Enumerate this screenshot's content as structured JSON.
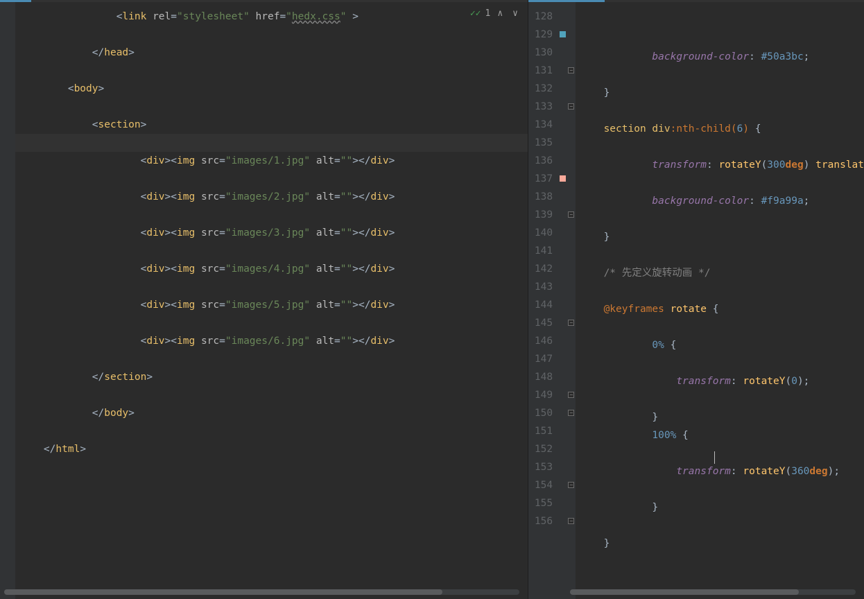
{
  "find": {
    "count": "1"
  },
  "left": {
    "startLine": 4,
    "highlightRow": 8,
    "lines": [
      {
        "indent": 4,
        "tokens": [
          [
            "punct",
            "<"
          ],
          [
            "tag",
            "link"
          ],
          [
            "punct",
            " "
          ],
          [
            "attr",
            "rel"
          ],
          [
            "punct",
            "="
          ],
          [
            "str",
            "\"stylesheet\""
          ],
          [
            "punct",
            " "
          ],
          [
            "attr",
            "href"
          ],
          [
            "punct",
            "="
          ],
          [
            "str",
            "\""
          ],
          [
            "href",
            "hedx.css"
          ],
          [
            "str",
            "\""
          ],
          [
            "punct",
            " >"
          ]
        ]
      },
      {
        "indent": 0,
        "tokens": []
      },
      {
        "indent": 3,
        "tokens": [
          [
            "punct",
            "</"
          ],
          [
            "tag",
            "head"
          ],
          [
            "punct",
            ">"
          ]
        ]
      },
      {
        "indent": 0,
        "tokens": []
      },
      {
        "indent": 2,
        "tokens": [
          [
            "punct",
            "<"
          ],
          [
            "tag",
            "body"
          ],
          [
            "punct",
            ">"
          ]
        ]
      },
      {
        "indent": 0,
        "tokens": []
      },
      {
        "indent": 3,
        "tokens": [
          [
            "punct",
            "<"
          ],
          [
            "tag",
            "section"
          ],
          [
            "punct",
            ">"
          ]
        ]
      },
      {
        "indent": 0,
        "tokens": []
      },
      {
        "indent": 5,
        "tokens": [
          [
            "punct",
            "<"
          ],
          [
            "tag",
            "div"
          ],
          [
            "punct",
            "><"
          ],
          [
            "tag",
            "img"
          ],
          [
            "punct",
            " "
          ],
          [
            "attr",
            "src"
          ],
          [
            "punct",
            "="
          ],
          [
            "str",
            "\"images/1.jpg\""
          ],
          [
            "punct",
            " "
          ],
          [
            "attr",
            "alt"
          ],
          [
            "punct",
            "="
          ],
          [
            "str",
            "\"\""
          ],
          [
            "punct",
            "></"
          ],
          [
            "tag",
            "div"
          ],
          [
            "punct",
            ">"
          ]
        ]
      },
      {
        "indent": 0,
        "tokens": []
      },
      {
        "indent": 5,
        "tokens": [
          [
            "punct",
            "<"
          ],
          [
            "tag",
            "div"
          ],
          [
            "punct",
            "><"
          ],
          [
            "tag",
            "img"
          ],
          [
            "punct",
            " "
          ],
          [
            "attr",
            "src"
          ],
          [
            "punct",
            "="
          ],
          [
            "str",
            "\"images/2.jpg\""
          ],
          [
            "punct",
            " "
          ],
          [
            "attr",
            "alt"
          ],
          [
            "punct",
            "="
          ],
          [
            "str",
            "\"\""
          ],
          [
            "punct",
            "></"
          ],
          [
            "tag",
            "div"
          ],
          [
            "punct",
            ">"
          ]
        ]
      },
      {
        "indent": 0,
        "tokens": []
      },
      {
        "indent": 5,
        "tokens": [
          [
            "punct",
            "<"
          ],
          [
            "tag",
            "div"
          ],
          [
            "punct",
            "><"
          ],
          [
            "tag",
            "img"
          ],
          [
            "punct",
            " "
          ],
          [
            "attr",
            "src"
          ],
          [
            "punct",
            "="
          ],
          [
            "str",
            "\"images/3.jpg\""
          ],
          [
            "punct",
            " "
          ],
          [
            "attr",
            "alt"
          ],
          [
            "punct",
            "="
          ],
          [
            "str",
            "\"\""
          ],
          [
            "punct",
            "></"
          ],
          [
            "tag",
            "div"
          ],
          [
            "punct",
            ">"
          ]
        ]
      },
      {
        "indent": 0,
        "tokens": []
      },
      {
        "indent": 5,
        "tokens": [
          [
            "punct",
            "<"
          ],
          [
            "tag",
            "div"
          ],
          [
            "punct",
            "><"
          ],
          [
            "tag",
            "img"
          ],
          [
            "punct",
            " "
          ],
          [
            "attr",
            "src"
          ],
          [
            "punct",
            "="
          ],
          [
            "str",
            "\"images/4.jpg\""
          ],
          [
            "punct",
            " "
          ],
          [
            "attr",
            "alt"
          ],
          [
            "punct",
            "="
          ],
          [
            "str",
            "\"\""
          ],
          [
            "punct",
            "></"
          ],
          [
            "tag",
            "div"
          ],
          [
            "punct",
            ">"
          ]
        ]
      },
      {
        "indent": 0,
        "tokens": []
      },
      {
        "indent": 5,
        "tokens": [
          [
            "punct",
            "<"
          ],
          [
            "tag",
            "div"
          ],
          [
            "punct",
            "><"
          ],
          [
            "tag",
            "img"
          ],
          [
            "punct",
            " "
          ],
          [
            "attr",
            "src"
          ],
          [
            "punct",
            "="
          ],
          [
            "str",
            "\"images/5.jpg\""
          ],
          [
            "punct",
            " "
          ],
          [
            "attr",
            "alt"
          ],
          [
            "punct",
            "="
          ],
          [
            "str",
            "\"\""
          ],
          [
            "punct",
            "></"
          ],
          [
            "tag",
            "div"
          ],
          [
            "punct",
            ">"
          ]
        ]
      },
      {
        "indent": 0,
        "tokens": []
      },
      {
        "indent": 5,
        "tokens": [
          [
            "punct",
            "<"
          ],
          [
            "tag",
            "div"
          ],
          [
            "punct",
            "><"
          ],
          [
            "tag",
            "img"
          ],
          [
            "punct",
            " "
          ],
          [
            "attr",
            "src"
          ],
          [
            "punct",
            "="
          ],
          [
            "str",
            "\"images/6.jpg\""
          ],
          [
            "punct",
            " "
          ],
          [
            "attr",
            "alt"
          ],
          [
            "punct",
            "="
          ],
          [
            "str",
            "\"\""
          ],
          [
            "punct",
            "></"
          ],
          [
            "tag",
            "div"
          ],
          [
            "punct",
            ">"
          ]
        ]
      },
      {
        "indent": 0,
        "tokens": []
      },
      {
        "indent": 3,
        "tokens": [
          [
            "punct",
            "</"
          ],
          [
            "tag",
            "section"
          ],
          [
            "punct",
            ">"
          ]
        ]
      },
      {
        "indent": 0,
        "tokens": []
      },
      {
        "indent": 3,
        "tokens": [
          [
            "punct",
            "</"
          ],
          [
            "tag",
            "body"
          ],
          [
            "punct",
            ">"
          ]
        ]
      },
      {
        "indent": 0,
        "tokens": []
      },
      {
        "indent": 1,
        "tokens": [
          [
            "punct",
            "</"
          ],
          [
            "tag",
            "html"
          ],
          [
            "punct",
            ">"
          ]
        ]
      }
    ]
  },
  "right": {
    "startLine": 128,
    "swatches": {
      "129": "#50a3bc",
      "137": "#f9a99a"
    },
    "folds": [
      131,
      133,
      139,
      145,
      149,
      150,
      154,
      156
    ],
    "lines": [
      {
        "indent": 0,
        "tokens": []
      },
      {
        "indent": 3,
        "tokens": [
          [
            "prop",
            "background-color"
          ],
          [
            "punct",
            ": "
          ],
          [
            "num",
            "#50a3bc"
          ],
          [
            "punct",
            ";"
          ]
        ]
      },
      {
        "indent": 0,
        "tokens": []
      },
      {
        "indent": 1,
        "tokens": [
          [
            "punct",
            "}"
          ]
        ]
      },
      {
        "indent": 0,
        "tokens": []
      },
      {
        "indent": 1,
        "tokens": [
          [
            "sel",
            "section"
          ],
          [
            "punct",
            " "
          ],
          [
            "sel",
            "div"
          ],
          [
            "pseudo",
            ":nth-child("
          ],
          [
            "num",
            "6"
          ],
          [
            "pseudo",
            ") "
          ],
          [
            "punct",
            "{"
          ]
        ]
      },
      {
        "indent": 0,
        "tokens": []
      },
      {
        "indent": 3,
        "tokens": [
          [
            "prop",
            "transform"
          ],
          [
            "punct",
            ": "
          ],
          [
            "func",
            "rotateY"
          ],
          [
            "punct",
            "("
          ],
          [
            "num",
            "300"
          ],
          [
            "unit",
            "deg"
          ],
          [
            "punct",
            ") "
          ],
          [
            "func",
            "translat"
          ]
        ]
      },
      {
        "indent": 0,
        "tokens": []
      },
      {
        "indent": 3,
        "tokens": [
          [
            "prop",
            "background-color"
          ],
          [
            "punct",
            ": "
          ],
          [
            "num",
            "#f9a99a"
          ],
          [
            "punct",
            ";"
          ]
        ]
      },
      {
        "indent": 0,
        "tokens": []
      },
      {
        "indent": 1,
        "tokens": [
          [
            "punct",
            "}"
          ]
        ]
      },
      {
        "indent": 0,
        "tokens": []
      },
      {
        "indent": 1,
        "tokens": [
          [
            "comment",
            "/* 先定义旋转动画 */"
          ]
        ]
      },
      {
        "indent": 0,
        "tokens": []
      },
      {
        "indent": 1,
        "tokens": [
          [
            "kw",
            "@keyframes"
          ],
          [
            "punct",
            " "
          ],
          [
            "ident",
            "rotate"
          ],
          [
            "punct",
            " {"
          ]
        ]
      },
      {
        "indent": 0,
        "tokens": []
      },
      {
        "indent": 3,
        "tokens": [
          [
            "num",
            "0%"
          ],
          [
            "punct",
            " {"
          ]
        ]
      },
      {
        "indent": 0,
        "tokens": []
      },
      {
        "indent": 4,
        "tokens": [
          [
            "prop",
            "transform"
          ],
          [
            "punct",
            ": "
          ],
          [
            "func",
            "rotateY"
          ],
          [
            "punct",
            "("
          ],
          [
            "num",
            "0"
          ],
          [
            "punct",
            ");"
          ]
        ]
      },
      {
        "indent": 0,
        "tokens": []
      },
      {
        "indent": 3,
        "tokens": [
          [
            "punct",
            "}"
          ]
        ]
      },
      {
        "indent": 3,
        "tokens": [
          [
            "num",
            "100%"
          ],
          [
            "punct",
            " {"
          ]
        ]
      },
      {
        "indent": 0,
        "tokens": []
      },
      {
        "indent": 4,
        "tokens": [
          [
            "prop",
            "transform"
          ],
          [
            "punct",
            ": "
          ],
          [
            "func",
            "rotateY"
          ],
          [
            "punct",
            "("
          ],
          [
            "num",
            "360"
          ],
          [
            "unit",
            "deg"
          ],
          [
            "punct",
            ");"
          ]
        ]
      },
      {
        "indent": 0,
        "tokens": []
      },
      {
        "indent": 3,
        "tokens": [
          [
            "punct",
            "}"
          ]
        ]
      },
      {
        "indent": 0,
        "tokens": []
      },
      {
        "indent": 1,
        "tokens": [
          [
            "punct",
            "}"
          ]
        ]
      }
    ]
  }
}
